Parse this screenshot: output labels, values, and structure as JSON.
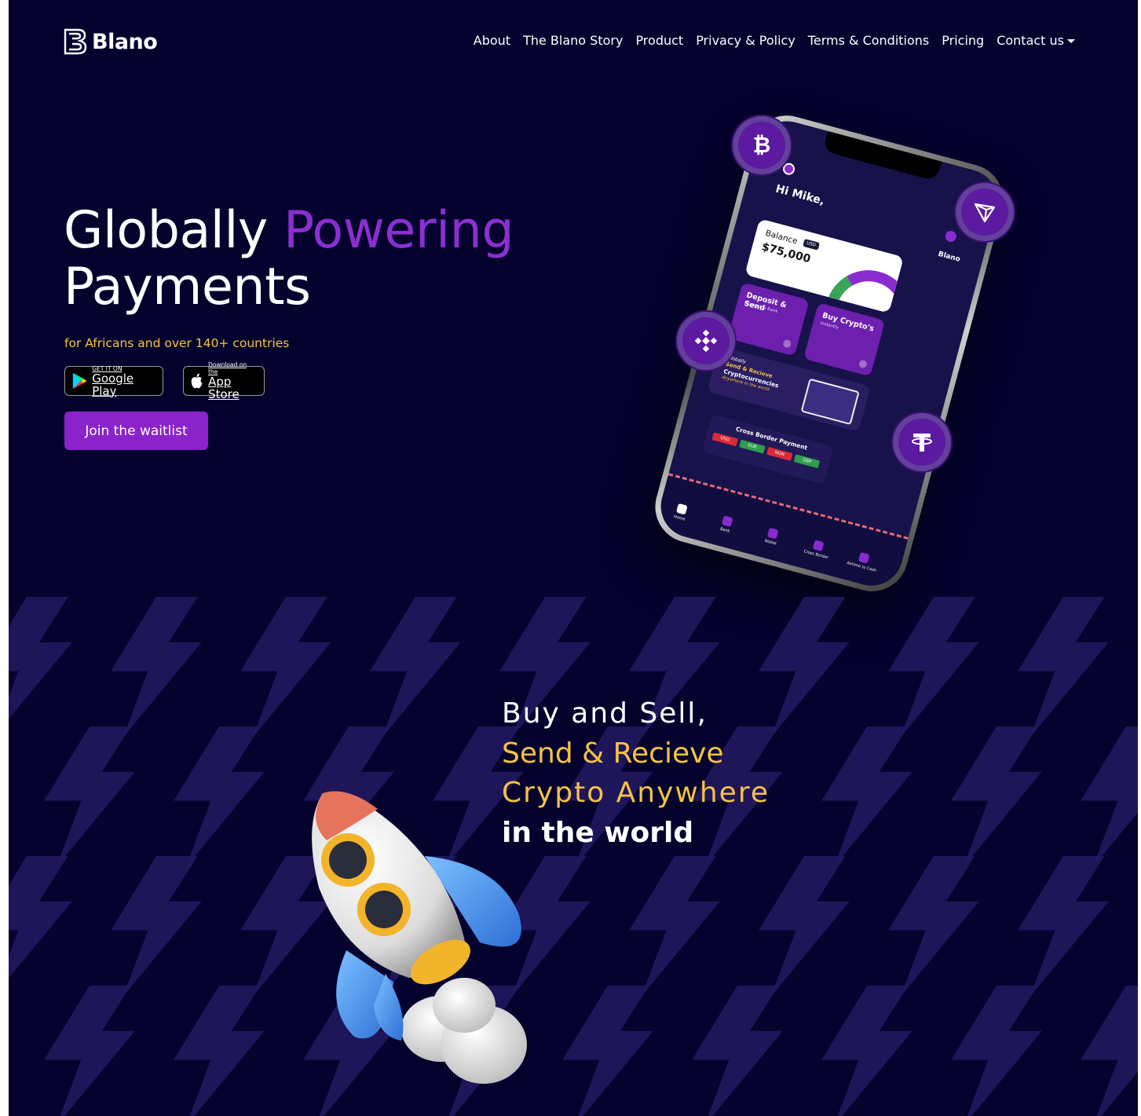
{
  "brand": {
    "name": "Blano"
  },
  "nav": {
    "items": [
      "About",
      "The Blano Story",
      "Product",
      "Privacy & Policy",
      "Terms & Conditions",
      "Pricing",
      "Contact us"
    ]
  },
  "hero": {
    "title_line1_white": "Globally ",
    "title_line1_purple": "Powering",
    "title_line2": "Payments",
    "subtitle": "for Africans and over 140+ countries",
    "google_play": {
      "small": "GET IT ON",
      "big": "Google Play"
    },
    "app_store": {
      "small": "Download on the",
      "big": "App Store"
    },
    "cta": "Join the waitlist"
  },
  "phone": {
    "greeting": "Hi Mike,",
    "brand": "Blano",
    "balance_label": "Balance",
    "currency_pill": "USD",
    "balance": "$75,000",
    "actions": [
      {
        "title": "Deposit & Send",
        "subtitle": "Money Via Bank"
      },
      {
        "title": "Buy Crypto's",
        "subtitle": "Instantly"
      }
    ],
    "promo": {
      "l1": "Globally",
      "l2": "Send & Recieve",
      "l3": "Cryptocurrencies",
      "l4": "Anywhere in the world"
    },
    "cross_border": {
      "title": "Cross Border Payment",
      "chips": [
        "USD",
        "EUR",
        "NGN",
        "GBP"
      ]
    },
    "tabs": [
      "Home",
      "Bank",
      "Wallet",
      "Cross Border",
      "Airtime to Cash"
    ]
  },
  "coins": [
    "bitcoin",
    "tron",
    "binance",
    "tether"
  ],
  "feature": {
    "line1": "Buy and Sell,",
    "line2": "Send & Recieve",
    "line3": "Crypto Anywhere",
    "line4": "in the world"
  },
  "colors": {
    "background": "#05032e",
    "purple": "#8a23c9",
    "accent_yellow": "#f5c243",
    "bolt": "#241a62"
  }
}
